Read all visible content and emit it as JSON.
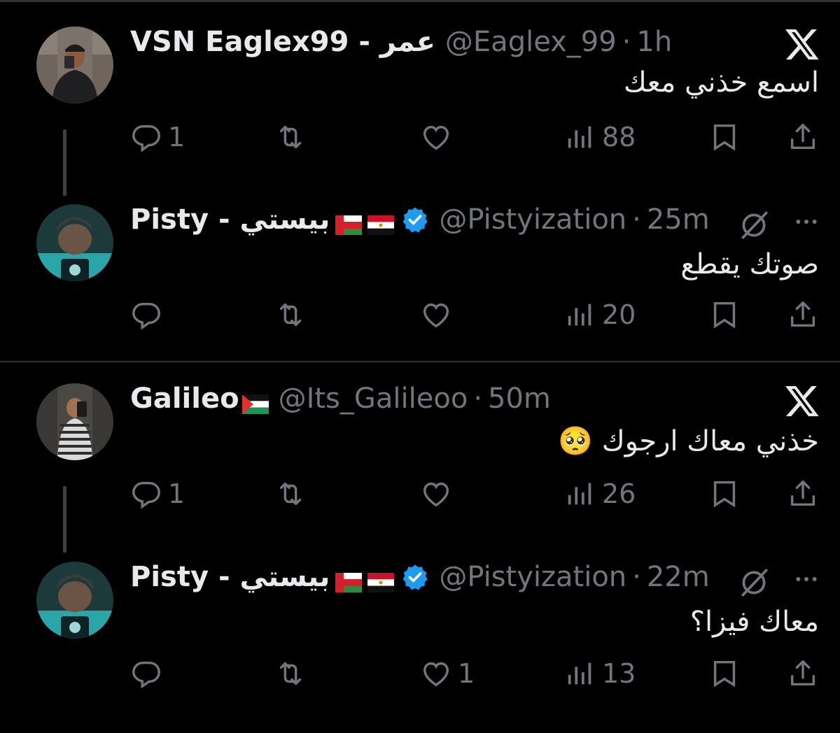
{
  "tweets": [
    {
      "name": "VSN Eaglex99 - عمر",
      "handle": "@Eaglex_99",
      "time": "1h",
      "text": "اسمع خذني معك",
      "reply_count": "1",
      "like_count": "",
      "views": "88",
      "flags": [],
      "verified": false,
      "right_icon": "x-logo-icon"
    },
    {
      "name": "Pisty - بيستي",
      "handle": "@Pistyization",
      "time": "25m",
      "text": "صوتك يقطع",
      "reply_count": "",
      "like_count": "",
      "views": "20",
      "flags": [
        "oman-flag-icon",
        "egypt-flag-icon"
      ],
      "verified": true,
      "right_icon": "grok-icon"
    },
    {
      "name": "Galileo",
      "handle": "@Its_Galileoo",
      "time": "50m",
      "text": "خذني معاك ارجوك 🥺",
      "reply_count": "1",
      "like_count": "",
      "views": "26",
      "flags": [
        "palestine-flag-icon"
      ],
      "verified": false,
      "right_icon": "x-logo-icon"
    },
    {
      "name": "Pisty - بيستي",
      "handle": "@Pistyization",
      "time": "22m",
      "text": "معاك فيزا؟",
      "reply_count": "",
      "like_count": "1",
      "views": "13",
      "flags": [
        "oman-flag-icon",
        "egypt-flag-icon"
      ],
      "verified": true,
      "right_icon": "grok-icon"
    }
  ],
  "dot": "·",
  "more_icon": "more-dots-icon",
  "colors": {
    "background": "#000000",
    "text": "#e7e9ea",
    "muted": "#71767b",
    "verified": "#1d9bf0",
    "divider": "#2f3336"
  }
}
